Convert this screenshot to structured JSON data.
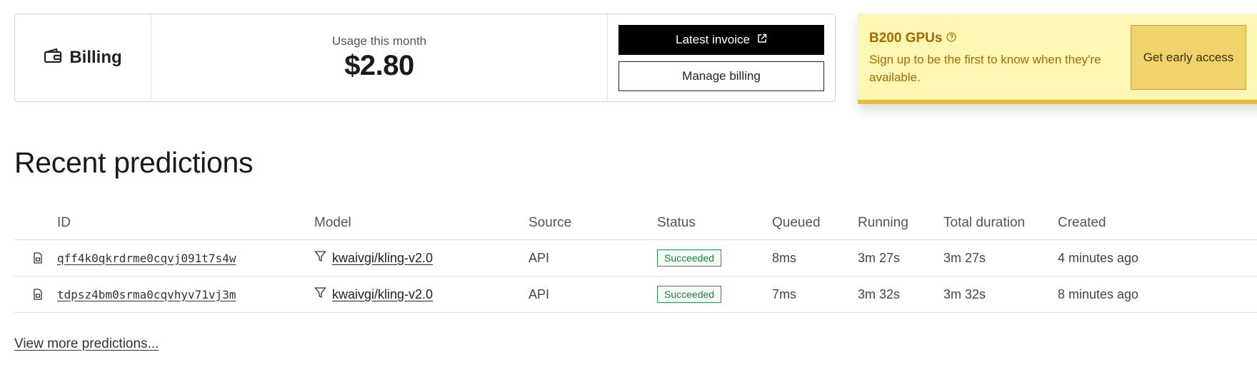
{
  "billing": {
    "title": "Billing",
    "usage_label": "Usage this month",
    "usage_value": "$2.80",
    "latest_invoice_label": "Latest invoice",
    "manage_billing_label": "Manage billing"
  },
  "promo": {
    "title": "B200 GPUs",
    "text": "Sign up to be the first to know when they're available.",
    "cta_label": "Get early access"
  },
  "predictions": {
    "heading": "Recent predictions",
    "columns": {
      "id": "ID",
      "model": "Model",
      "source": "Source",
      "status": "Status",
      "queued": "Queued",
      "running": "Running",
      "total": "Total duration",
      "created": "Created"
    },
    "rows": [
      {
        "id": "qff4k0qkrdrme0cqvj091t7s4w",
        "model": "kwaivgi/kling-v2.0",
        "source": "API",
        "status": "Succeeded",
        "queued": "8ms",
        "running": "3m 27s",
        "total": "3m 27s",
        "created": "4 minutes ago"
      },
      {
        "id": "tdpsz4bm0srma0cqvhyv71vj3m",
        "model": "kwaivgi/kling-v2.0",
        "source": "API",
        "status": "Succeeded",
        "queued": "7ms",
        "running": "3m 32s",
        "total": "3m 32s",
        "created": "8 minutes ago"
      }
    ],
    "view_more_label": "View more predictions..."
  },
  "icons": {
    "billing": "wallet-icon",
    "invoice": "external-link-icon",
    "promo": "help-circle-icon",
    "row": "document-icon",
    "model": "filter-icon"
  },
  "colors": {
    "promo_bg": "#fef7b3",
    "promo_text": "#a16b07",
    "promo_button": "#f2d36b",
    "status_success": "#2a7a45",
    "primary_button": "#000000"
  }
}
